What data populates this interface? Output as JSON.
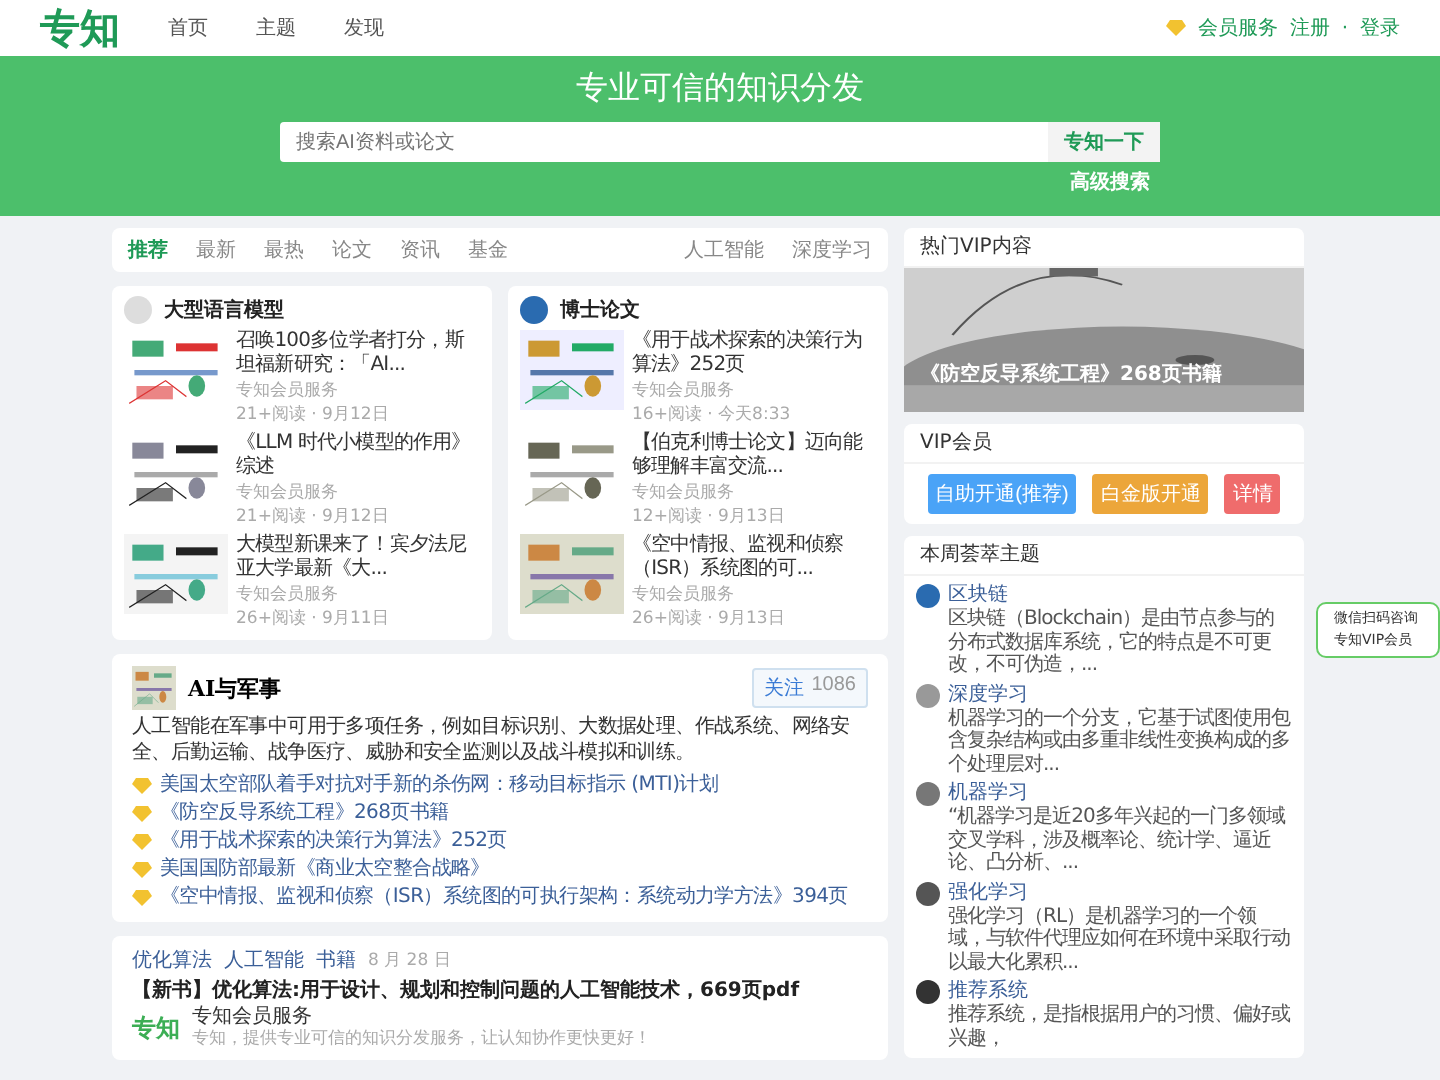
{
  "header": {
    "logo": "专知",
    "nav": [
      {
        "label": "首页"
      },
      {
        "label": "主题"
      },
      {
        "label": "发现"
      }
    ],
    "vip": "会员服务",
    "register": "注册",
    "separator": "·",
    "login": "登录"
  },
  "banner": {
    "title": "专业可信的知识分发",
    "search": {
      "placeholder": "搜索AI资料或论文"
    },
    "search_button": "专知一下",
    "advanced": "高级搜索"
  },
  "tabs": [
    {
      "label": "推荐",
      "selected": true
    },
    {
      "label": "最新",
      "selected": false
    },
    {
      "label": "最热",
      "selected": false
    },
    {
      "label": "论文",
      "selected": false
    },
    {
      "label": "资讯",
      "selected": false
    },
    {
      "label": "基金",
      "selected": false
    }
  ],
  "topic_tabs": [
    "人工智能",
    "深度学习"
  ],
  "cards": [
    {
      "title": "大型语言模型",
      "items": [
        {
          "title": "召唤100多位学者打分，斯坦福新研究：「AI...",
          "source": "专知会员服务",
          "meta": "21+阅读 · 9月12日"
        },
        {
          "title": "《LLM 时代小模型的作用》综述",
          "source": "专知会员服务",
          "meta": "21+阅读 · 9月12日"
        },
        {
          "title": "大模型新课来了！宾夕法尼亚大学最新《大...",
          "source": "专知会员服务",
          "meta": "26+阅读 · 9月11日"
        }
      ]
    },
    {
      "title": "博士论文",
      "items": [
        {
          "title": "《用于战术探索的决策行为算法》252页",
          "source": "专知会员服务",
          "meta": "16+阅读 · 今天8:33"
        },
        {
          "title": "【伯克利博士论文】迈向能够理解丰富交流...",
          "source": "专知会员服务",
          "meta": "12+阅读 · 9月13日"
        },
        {
          "title": "《空中情报、监视和侦察（ISR）系统图的可...",
          "source": "专知会员服务",
          "meta": "26+阅读 · 9月13日"
        }
      ]
    }
  ],
  "topic_card": {
    "title": "AI与军事",
    "follow": "关注",
    "followers": "1086",
    "description": "人工智能在军事中可用于多项任务，例如目标识别、大数据处理、作战系统、网络安全、后勤运输、战争医疗、威胁和安全监测以及战斗模拟和训练。",
    "links": [
      "美国太空部队着手对抗对手新的杀伤网：移动目标指示 (MTI)计划",
      "《防空反导系统工程》268页书籍",
      "《用于战术探索的决策行为算法》252页",
      "美国国防部最新《商业太空整合战略》",
      "《空中情报、监视和侦察（ISR）系统图的可执行架构：系统动力学方法》394页"
    ]
  },
  "post": {
    "tags": [
      "优化算法",
      "人工智能",
      "书籍"
    ],
    "date": "8 月 28 日",
    "title": "【新书】优化算法:用于设计、规划和控制问题的人工智能技术，669页pdf",
    "author_logo": "专知",
    "author": "专知会员服务",
    "author_bio": "专知，提供专业可信的知识分发服务，让认知协作更快更好！"
  },
  "hot_vip": {
    "title": "热门VIP内容",
    "caption": "《防空反导系统工程》268页书籍"
  },
  "vip": {
    "title": "VIP会员",
    "buttons": [
      {
        "label": "自助开通(推荐)",
        "kind": "blue"
      },
      {
        "label": "白金版开通",
        "kind": "orange"
      },
      {
        "label": "详情",
        "kind": "red"
      }
    ]
  },
  "weekly": {
    "title": "本周荟萃主题",
    "topics": [
      {
        "name": "区块链",
        "desc": "区块链（Blockchain）是由节点参与的分布式数据库系统，它的特点是不可更改，不可伪造，..."
      },
      {
        "name": "深度学习",
        "desc": "机器学习的一个分支，它基于试图使用包含复杂结构或由多重非线性变换构成的多个处理层对..."
      },
      {
        "name": "机器学习",
        "desc": "“机器学习是近20多年兴起的一门多领域交叉学科，涉及概率论、统计学、逼近论、凸分析、..."
      },
      {
        "name": "强化学习",
        "desc": "强化学习（RL）是机器学习的一个领域，与软件代理应如何在环境中采取行动以最大化累积..."
      },
      {
        "name": "推荐系统",
        "desc": "推荐系统，是指根据用户的习惯、偏好或兴趣，"
      }
    ]
  },
  "wechat": {
    "line1": "微信扫码咨询",
    "line2": "专知VIP会员"
  }
}
